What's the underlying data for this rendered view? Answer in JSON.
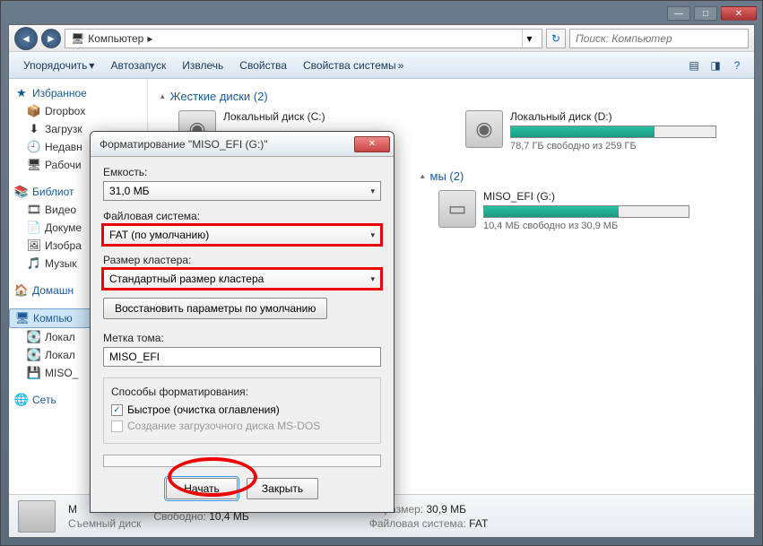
{
  "titlebar": {
    "min": "—",
    "max": "□",
    "close": "✕"
  },
  "address": {
    "root": "Компьютер",
    "sep": "▸",
    "search_placeholder": "Поиск: Компьютер"
  },
  "toolbar": {
    "organize": "Упорядочить",
    "autoplay": "Автозапуск",
    "extract": "Извлечь",
    "properties": "Свойства",
    "sys_properties": "Свойства системы"
  },
  "sidebar": {
    "favorites": "Избранное",
    "fav_items": [
      "Dropbox",
      "Загрузк",
      "Недавн",
      "Рабочи"
    ],
    "libraries": "Библиот",
    "lib_items": [
      "Видео",
      "Докуме",
      "Изобра",
      "Музык"
    ],
    "homegroup": "Домашн",
    "computer": "Компью",
    "comp_items": [
      "Локал",
      "Локал",
      "MISO_"
    ],
    "network": "Сеть"
  },
  "sections": {
    "hdd": "Жесткие диски (2)",
    "removable": "мы (2)"
  },
  "drives": {
    "c": {
      "name": "Локальный диск (C:)",
      "free": ""
    },
    "d": {
      "name": "Локальный диск (D:)",
      "free": "78,7 ГБ свободно из 259 ГБ",
      "fill": 70
    },
    "miso": {
      "name": "MISO_EFI (G:)",
      "free": "10,4 МБ свободно из 30,9 МБ",
      "fill": 66
    }
  },
  "status": {
    "name": "M",
    "type": "Съемный диск",
    "size_lbl": "ий размер:",
    "size": "30,9 МБ",
    "free_lbl": "Свободно:",
    "free": "10,4 МБ",
    "fs_lbl": "Файловая система:",
    "fs": "FAT"
  },
  "dialog": {
    "title": "Форматирование \"MISO_EFI (G:)\"",
    "capacity_lbl": "Емкость:",
    "capacity": "31,0 МБ",
    "fs_lbl": "Файловая система:",
    "fs": "FAT (по умолчанию)",
    "cluster_lbl": "Размер кластера:",
    "cluster": "Стандартный размер кластера",
    "restore": "Восстановить параметры по умолчанию",
    "label_lbl": "Метка тома:",
    "label": "MISO_EFI",
    "methods": "Способы форматирования:",
    "quick": "Быстрое (очистка оглавления)",
    "msdos": "Создание загрузочного диска MS-DOS",
    "start": "Начать",
    "close": "Закрыть"
  }
}
